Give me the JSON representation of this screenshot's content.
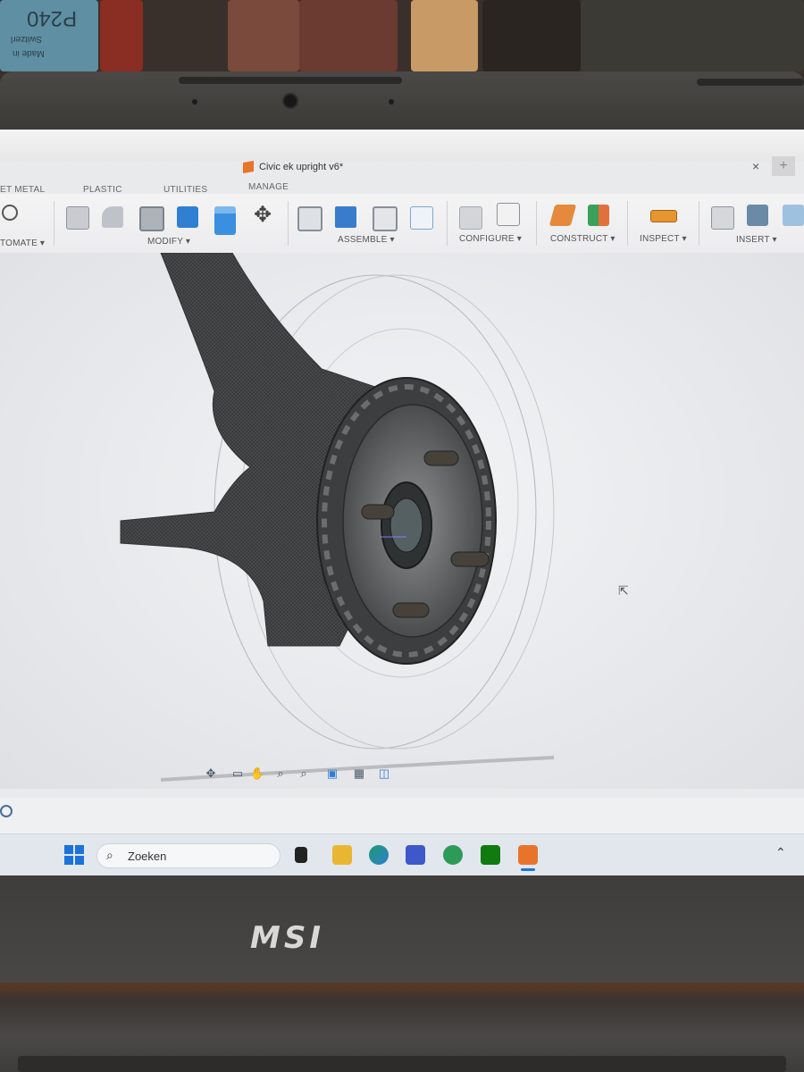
{
  "window": {
    "doc_title": "Civic ek upright v6*",
    "close": "×",
    "new_tab": "+"
  },
  "tabs": [
    "ET METAL",
    "PLASTIC",
    "UTILITIES",
    "MANAGE"
  ],
  "groups": {
    "automate": "TOMATE ▾",
    "modify": "MODIFY ▾",
    "assemble": "ASSEMBLE ▾",
    "configure": "CONFIGURE ▾",
    "construct": "CONSTRUCT ▾",
    "inspect": "INSPECT ▾",
    "insert": "INSERT ▾"
  },
  "taskbar": {
    "search_placeholder": "Zoeken"
  },
  "shelf": {
    "label_1": "P240",
    "label_2": "Switzerl",
    "label_3": "Made in"
  },
  "brand": "MSI",
  "colors": {
    "accent_orange": "#e8742b",
    "toolbar_blue": "#2f7fd3",
    "construct_orange": "#e58a3c",
    "inspect_orange": "#e6962f"
  }
}
